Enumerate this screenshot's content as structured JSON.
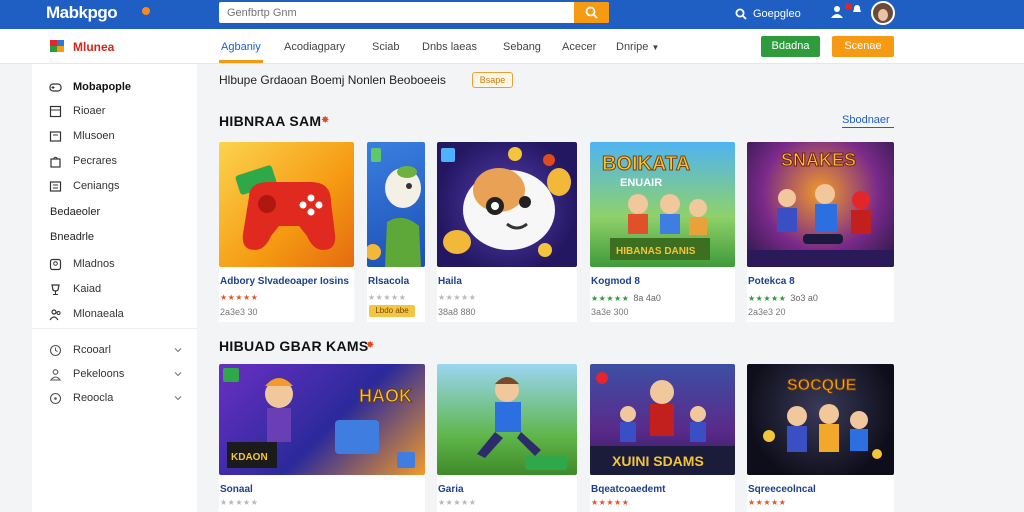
{
  "app": {
    "logo": "Mabkpgo",
    "brand": "Mlunea",
    "search_placeholder": "Genfbrtp Gnm",
    "top_link": "Goepgleo",
    "accent": "#1f5fc4",
    "orange": "#f59a12"
  },
  "nav": {
    "items": [
      "Agbaniy",
      "Acodiagpary",
      "Sciab",
      "Dnbs laeas",
      "Sebang",
      "Acecer",
      "Dnripe"
    ],
    "btn_green": "Bdadna",
    "btn_orange": "Scenae"
  },
  "sidebar": {
    "items": [
      {
        "label": "Mobapople",
        "icon": "gamepad-icon"
      },
      {
        "label": "Rioaer",
        "icon": "grid-icon"
      },
      {
        "label": "Mlusoen",
        "icon": "folder-icon"
      },
      {
        "label": "Pecrares",
        "icon": "bag-icon"
      },
      {
        "label": "Ceniangs",
        "icon": "list-icon"
      }
    ],
    "heading1": "Bedaeoler",
    "heading2": "Bneadrle",
    "items2": [
      {
        "label": "Mladnos",
        "icon": "person-icon"
      },
      {
        "label": "Kaiad",
        "icon": "trophy-icon"
      },
      {
        "label": "Mlonaeala",
        "icon": "people-icon"
      }
    ],
    "items3": [
      {
        "label": "Rcooarl",
        "icon": "clock-icon"
      },
      {
        "label": "Pekeloons",
        "icon": "user-icon"
      },
      {
        "label": "Reoocla",
        "icon": "info-icon"
      }
    ]
  },
  "filters": {
    "text": "Hlbupe Grdaoan   Boemj  Nonlen  Beoboeeis",
    "tag": "Bsape"
  },
  "section1": {
    "title": "HIBNRAA SAM",
    "see_all": "Sbodnaer",
    "cards": [
      {
        "title": "Adbory Slvadeoaper Iosins",
        "stars": "★★★★★",
        "rating": "",
        "downloads": "2a3e3 30",
        "stars_color": "red"
      },
      {
        "title": "Rlsacola",
        "stars": "★★★★★",
        "rating": "",
        "downloads": "",
        "stars_color": "grey",
        "tag": "Lbdo abe"
      },
      {
        "title": "Haila",
        "stars": "★★★★★",
        "rating": "",
        "downloads": "38a8 880",
        "stars_color": "grey"
      },
      {
        "title": "Kogmod 8",
        "stars": "★★★★★",
        "rating": "8a 4a0",
        "downloads": "3a3e 300",
        "stars_color": "green"
      },
      {
        "title": "Potekca 8",
        "stars": "★★★★★",
        "rating": "3o3 a0",
        "downloads": "2a3e3 20",
        "stars_color": "green"
      }
    ]
  },
  "section2": {
    "title": "HIBUAD GBAR KAMS",
    "cards": [
      {
        "title": "Sonaal",
        "stars": "★★★★★",
        "downloads": ""
      },
      {
        "title": "Garia",
        "stars": "★★★★★",
        "downloads": ""
      },
      {
        "title": "Bqeatcoaedemt",
        "stars": "★★★★★",
        "downloads": ""
      },
      {
        "title": "Sqreeceolncal",
        "stars": "★★★★★",
        "downloads": ""
      }
    ]
  }
}
